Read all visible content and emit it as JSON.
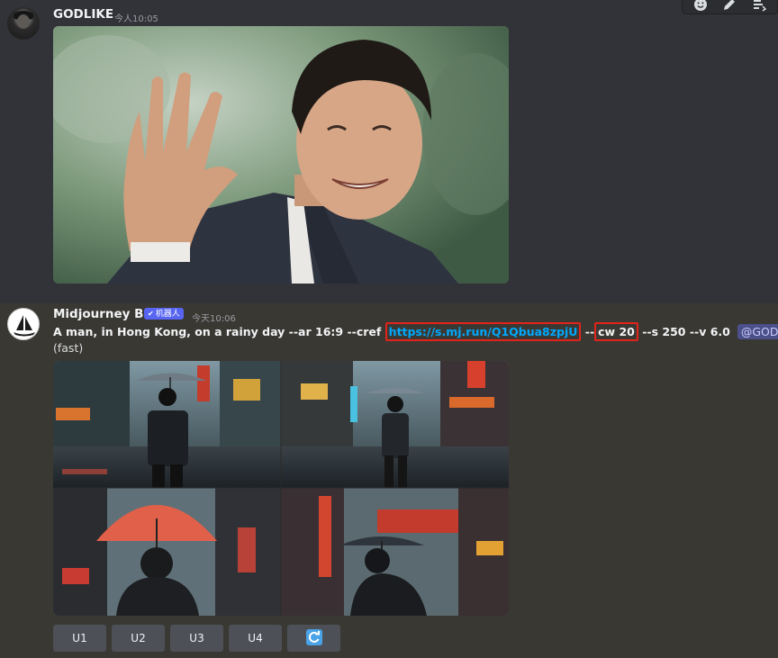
{
  "message1": {
    "username": "GODLIKE",
    "timestamp": "今人10:05"
  },
  "message2": {
    "username": "Midjourney Bot",
    "bot_badge": "机器人",
    "timestamp": "今天10:06",
    "prompt_text": "A man, in Hong Kong, on a rainy day --ar 16:9 --cref ",
    "cref_link": "https://s.mj.run/Q1Qbua8zpjU",
    "cw_prefix": " --",
    "cw_value": "cw 20",
    "rest": " --s 250 --v 6.0",
    "mention": "@GODLIKE",
    "mode": "(fast)"
  },
  "buttons": {
    "u1": "U1",
    "u2": "U2",
    "u3": "U3",
    "u4": "U4"
  },
  "icons": [
    "emoji-icon",
    "edit-icon",
    "thread-icon",
    "refresh-icon",
    "verified-check-icon"
  ],
  "colors": {
    "link": "#00a8fc",
    "highlight_box": "#e2231a",
    "bot_badge": "#5865f2",
    "button": "#4e5058"
  }
}
